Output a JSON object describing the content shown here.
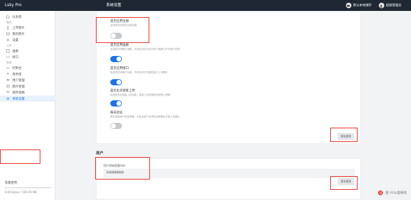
{
  "app": {
    "brand": "Lsky Pro",
    "page_title": "系统设置"
  },
  "topbar": {
    "btn1": "默认本地储存",
    "btn2": "超级管理员"
  },
  "sidebar": {
    "sections": [
      {
        "type": "item",
        "label": "仪表盘",
        "icon": "home-icon"
      },
      {
        "type": "section",
        "label": "我的"
      },
      {
        "type": "item",
        "label": "上传图片",
        "icon": "upload-icon"
      },
      {
        "type": "item",
        "label": "我的图片",
        "icon": "image-icon"
      },
      {
        "type": "item",
        "label": "设置",
        "icon": "gear-icon"
      },
      {
        "type": "section",
        "label": "公共"
      },
      {
        "type": "item",
        "label": "画廊",
        "icon": "gallery-icon"
      },
      {
        "type": "item",
        "label": "接口",
        "icon": "api-icon"
      },
      {
        "type": "section",
        "label": "系统"
      },
      {
        "type": "item",
        "label": "控制台",
        "icon": "dashboard-icon"
      },
      {
        "type": "item",
        "label": "角色组",
        "icon": "group-icon"
      },
      {
        "type": "item",
        "label": "用户管理",
        "icon": "users-icon"
      },
      {
        "type": "item",
        "label": "图片管理",
        "icon": "images-icon"
      },
      {
        "type": "item",
        "label": "储存策略",
        "icon": "storage-icon"
      },
      {
        "type": "item",
        "label": "系统设置",
        "icon": "settings-icon",
        "active": true
      }
    ],
    "storage": {
      "title": "容量使用",
      "value": "0.00 Bytes / 500.00 MB"
    }
  },
  "options": [
    {
      "label": "是否启用注册",
      "desc": "启用或关闭系统注册功能",
      "on": false
    },
    {
      "label": "是否启用画廊",
      "desc": "启用或关闭图片画廊，关闭后将无法访问用户画廊公开页面与列表",
      "on": true
    },
    {
      "label": "是否启用接口",
      "desc": "启用或关闭接口功能，关闭后将无法通过接口上传图片",
      "on": true
    },
    {
      "label": "是否允许游客上传",
      "desc": "启用或关闭游客上传功能，游客上传将使用系统默认策略",
      "on": true
    },
    {
      "label": "账号验证",
      "desc": "是否强制用户验证邮箱，开启后用户必须验证邮箱后才能上传图片",
      "on": false
    }
  ],
  "panel1": {
    "save": "保存更改"
  },
  "user_section": {
    "heading": "用户",
    "field_label": "用户初始容量(kb)",
    "field_value": "100000000",
    "save": "保存更改"
  },
  "watermark": "值 什么值得买"
}
